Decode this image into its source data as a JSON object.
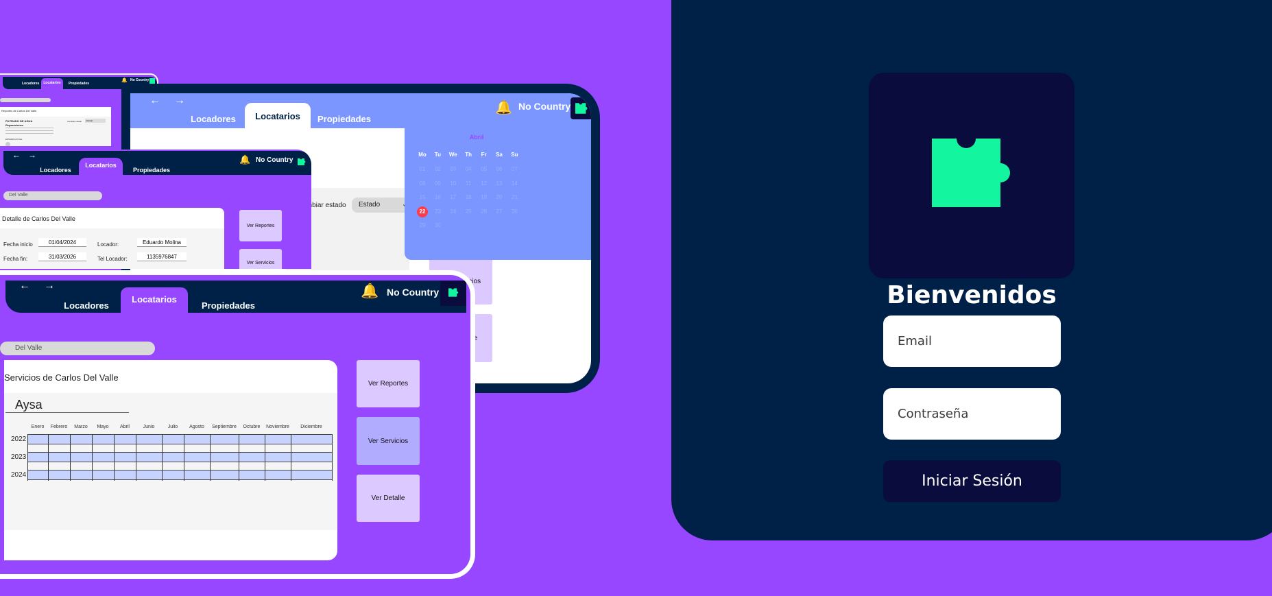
{
  "login": {
    "title": "Bienvenidos",
    "email_placeholder": "Email",
    "password_placeholder": "Contraseña",
    "submit_label": "Iniciar Sesión",
    "logo_icon": "puzzle-icon",
    "logo_color": "#14f5a0"
  },
  "colors": {
    "background": "#9747ff",
    "navy": "#002147",
    "dark_navy": "#0b0c3e",
    "accent_green": "#14f5a0",
    "periwinkle": "#7b97ff",
    "lavender_button": "#dbc9ff"
  },
  "nav": {
    "tabs": [
      "Locadores",
      "Locatarios",
      "Propiedades"
    ],
    "brand": "No Country"
  },
  "front_card": {
    "search_value": "Del Valle",
    "panel_title": "Servicios de Carlos Del Valle",
    "service_name": "Aysa",
    "months": [
      "Enero",
      "Febrero",
      "Marzo",
      "Mayo",
      "Abril",
      "Junio",
      "Julio",
      "Agosto",
      "Septiembre",
      "Octubre",
      "Noviembre",
      "Diciembre"
    ],
    "years": [
      "2022",
      "2023",
      "2024"
    ],
    "buttons": [
      "Ver Reportes",
      "Ver Servicios",
      "Ver Detalle"
    ]
  },
  "big_card": {
    "status_label": "Cambiar estado",
    "status_value": "Estado",
    "buttons": [
      "Ver Servicios",
      "Ver Detalle"
    ],
    "calendar": {
      "month": "Abril",
      "weekdays": [
        "Mo",
        "Tu",
        "We",
        "Th",
        "Fr",
        "Sa",
        "Su"
      ],
      "days": [
        [
          "01",
          "02",
          "03",
          "04",
          "05",
          "06",
          "07"
        ],
        [
          "08",
          "09",
          "10",
          "11",
          "12",
          "13",
          "14"
        ],
        [
          "15",
          "16",
          "17",
          "18",
          "19",
          "20",
          "21"
        ],
        [
          "22",
          "23",
          "24",
          "25",
          "26",
          "27",
          "28"
        ],
        [
          "29",
          "30"
        ]
      ],
      "selected_day": "22"
    }
  },
  "middle_card": {
    "search_value": "Del Valle",
    "panel_title": "Detalle de Carlos Del Valle",
    "fields": [
      {
        "label": "Fecha inicio",
        "value": "01/04/2024"
      },
      {
        "label": "Locador:",
        "value": "Eduardo Molina"
      },
      {
        "label": "Fecha fin:",
        "value": "31/03/2026"
      },
      {
        "label": "Tel Locador:",
        "value": "1135976847"
      }
    ],
    "buttons": [
      "Ver Reportes",
      "Ver Servicios"
    ]
  },
  "small_card": {
    "panel_title": "Reportes de Carlos Del Valle",
    "report_title": "FILTRADO DE AGUA",
    "report_subtitle": "Reparaciones",
    "filter_label": "Cambiar estado",
    "filter_value": "Estado",
    "status_text": "ESTADO ACTUAL"
  }
}
